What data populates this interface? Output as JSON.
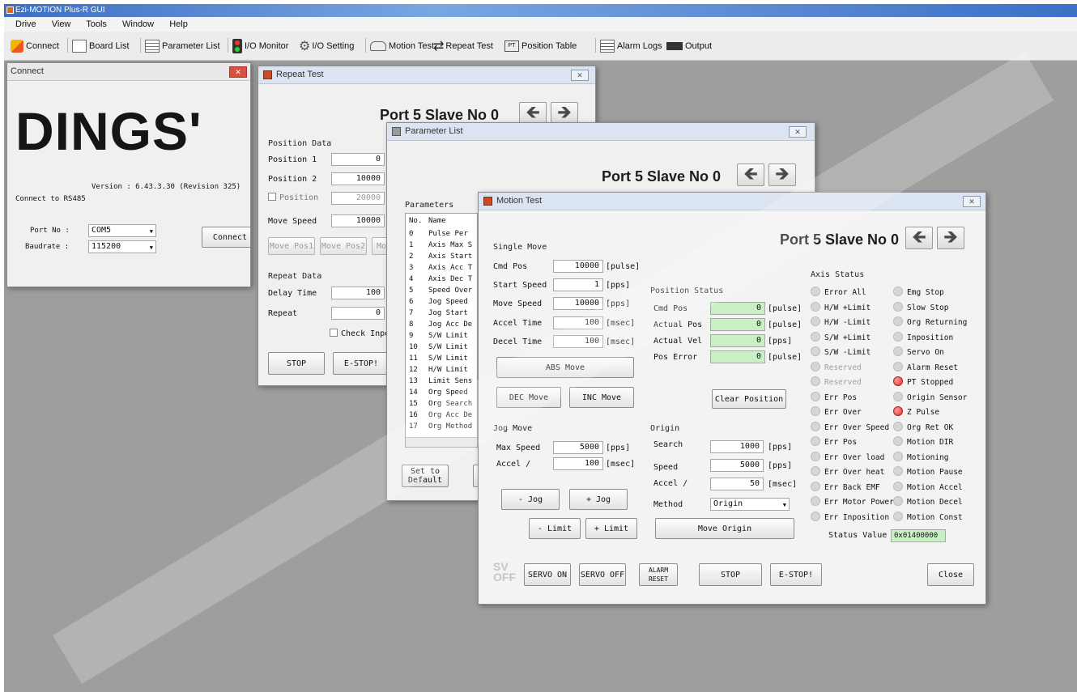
{
  "app": {
    "title": "Ezi-MOTION Plus-R GUI"
  },
  "menu": [
    "Drive",
    "View",
    "Tools",
    "Window",
    "Help"
  ],
  "toolbar": {
    "connect": "Connect",
    "board_list": "Board List",
    "parameter_list": "Parameter List",
    "io_monitor": "I/O Monitor",
    "io_setting": "I/O Setting",
    "motion_test": "Motion Test",
    "repeat_test": "Repeat Test",
    "position_table": "Position Table",
    "alarm_logs": "Alarm Logs",
    "output": "Output"
  },
  "connect": {
    "title": "Connect",
    "logo": "DINGS'",
    "version": "Version : 6.43.3.30 (Revision 325)",
    "connect_to": "Connect to RS485",
    "port_label": "Port No :",
    "port_value": "COM5",
    "baud_label": "Baudrate :",
    "baud_value": "115200",
    "connect_button": "Connect"
  },
  "repeat": {
    "title": "Repeat Test",
    "header": "Port 5 Slave No 0",
    "position_data": "Position Data",
    "pos1_label": "Position 1",
    "pos1": "0",
    "pos2_label": "Position 2",
    "pos2": "10000",
    "pos3_label": "Position",
    "pos3": "20000",
    "speed_label": "Move Speed",
    "speed": "10000",
    "btn_a": "Move Pos1",
    "btn_b": "Move Pos2",
    "btn_c": "Mov",
    "repeat_data": "Repeat Data",
    "delay_label": "Delay Time",
    "delay": "100",
    "repeat_label": "Repeat",
    "repeat": "0",
    "check": "Check Inpos",
    "stop": "STOP",
    "estop": "E-STOP!"
  },
  "param": {
    "title": "Parameter List",
    "header": "Port 5 Slave No 0",
    "params_label": "Parameters",
    "col_no": "No.",
    "col_name": "Name",
    "rows": [
      {
        "no": "0",
        "name": "Pulse Per"
      },
      {
        "no": "1",
        "name": "Axis Max S"
      },
      {
        "no": "2",
        "name": "Axis Start"
      },
      {
        "no": "3",
        "name": "Axis Acc T"
      },
      {
        "no": "4",
        "name": "Axis Dec T"
      },
      {
        "no": "5",
        "name": "Speed Over"
      },
      {
        "no": "6",
        "name": "Jog Speed"
      },
      {
        "no": "7",
        "name": "Jog Start"
      },
      {
        "no": "8",
        "name": "Jog Acc De"
      },
      {
        "no": "9",
        "name": "S/W Limit"
      },
      {
        "no": "10",
        "name": "S/W Limit"
      },
      {
        "no": "11",
        "name": "S/W Limit"
      },
      {
        "no": "12",
        "name": "H/W Limit"
      },
      {
        "no": "13",
        "name": "Limit Sens"
      },
      {
        "no": "14",
        "name": "Org Speed"
      },
      {
        "no": "15",
        "name": "Org Search"
      },
      {
        "no": "16",
        "name": "Org Acc De"
      },
      {
        "no": "17",
        "name": "Org Method"
      }
    ],
    "default_btn": "Set to\nDefault"
  },
  "motion": {
    "title": "Motion Test",
    "header": "Port 5 Slave No 0",
    "single_move": "Single Move",
    "cmd_pos_label": "Cmd Pos",
    "cmd_pos": "10000",
    "cmd_pos_unit": "[pulse]",
    "start_speed_label": "Start Speed",
    "start_speed": "1",
    "start_speed_unit": "[pps]",
    "move_speed_label": "Move Speed",
    "move_speed": "10000",
    "move_speed_unit": "[pps]",
    "accel_label": "Accel Time",
    "accel": "100",
    "accel_unit": "[msec]",
    "decel_label": "Decel Time",
    "decel": "100",
    "decel_unit": "[msec]",
    "abs_move": "ABS Move",
    "dec_move": "DEC Move",
    "inc_move": "INC Move",
    "position_status": "Position Status",
    "ps_cmd_label": "Cmd Pos",
    "ps_cmd": "0",
    "ps_cmd_unit": "[pulse]",
    "ps_act_label": "Actual Pos",
    "ps_act": "0",
    "ps_act_unit": "[pulse]",
    "ps_vel_label": "Actual Vel",
    "ps_vel": "0",
    "ps_vel_unit": "[pps]",
    "ps_err_label": "Pos Error",
    "ps_err": "0",
    "ps_err_unit": "[pulse]",
    "clear_position": "Clear Position",
    "jog_move": "Jog Move",
    "jog_speed_label": "Max Speed",
    "jog_speed": "5000",
    "jog_speed_unit": "[pps]",
    "jog_accel_label": "Accel /",
    "jog_accel": "100",
    "jog_accel_unit": "[msec]",
    "jog_minus": "- Jog",
    "jog_plus": "+ Jog",
    "limit_minus": "- Limit",
    "limit_plus": "+ Limit",
    "origin": "Origin",
    "org_search_label": "Search",
    "org_search": "1000",
    "org_search_unit": "[pps]",
    "org_speed_label": "Speed",
    "org_speed": "5000",
    "org_speed_unit": "[pps]",
    "org_accel_label": "Accel /",
    "org_accel": "50",
    "org_accel_unit": "[msec]",
    "org_method_label": "Method",
    "org_method": "Origin",
    "move_origin": "Move Origin",
    "axis_status": "Axis Status",
    "status_left": [
      "Error All",
      "H/W +Limit",
      "H/W -Limit",
      "S/W +Limit",
      "S/W -Limit",
      "Reserved",
      "Reserved",
      "Err Pos",
      "Err Over",
      "Err Over Speed",
      "Err Pos",
      "Err Over load",
      "Err Over heat",
      "Err Back EMF",
      "Err Motor Power",
      "Err Inposition"
    ],
    "status_right": [
      "Emg Stop",
      "Slow Stop",
      "Org Returning",
      "Inposition",
      "Servo On",
      "Alarm Reset",
      "PT Stopped",
      "Origin Sensor",
      "Z Pulse",
      "Org Ret OK",
      "Motion DIR",
      "Motioning",
      "Motion Pause",
      "Motion Accel",
      "Motion Decel",
      "Motion Const"
    ],
    "status_value_label": "Status Value",
    "status_value": "0x01400000",
    "sv_off": "SV\nOFF",
    "servo_on": "SERVO ON",
    "servo_off": "SERVO OFF",
    "alarm_reset": "ALARM\nRESET",
    "stop": "STOP",
    "estop": "E-STOP!",
    "close": "Close"
  }
}
